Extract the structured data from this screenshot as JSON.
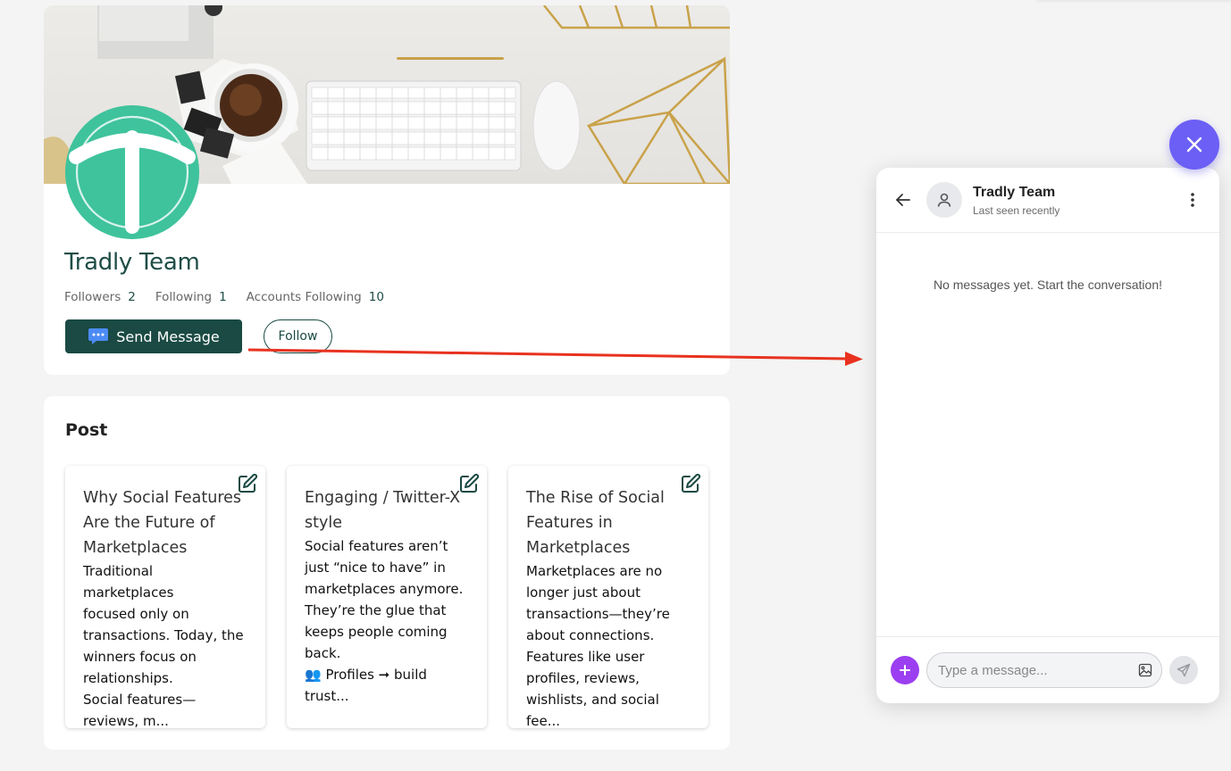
{
  "profile": {
    "name": "Tradly Team",
    "stats": [
      {
        "label": "Followers",
        "value": "2"
      },
      {
        "label": "Following",
        "value": "1"
      },
      {
        "label": "Accounts Following",
        "value": "10"
      }
    ],
    "send_message_label": "Send Message",
    "follow_label": "Follow"
  },
  "posts": {
    "heading": "Post",
    "items": [
      {
        "title": "Why Social Features\nAre the Future of\nMarketplaces",
        "body": "Traditional marketplaces\nfocused only on\ntransactions. Today, the\nwinners focus on\nrelationships.\nSocial features—\nreviews, m..."
      },
      {
        "title": "Engaging / Twitter-X\nstyle",
        "body": "Social features aren’t\njust “nice to have” in\nmarketplaces anymore.\nThey’re the glue that\nkeeps people coming\nback.\n👥 Profiles ➞ build\ntrust..."
      },
      {
        "title": "The Rise of Social\nFeatures in\nMarketplaces",
        "body": "Marketplaces are no\nlonger just about\ntransactions—they’re\nabout connections.\nFeatures like user\nprofiles, reviews,\nwishlists, and social fee..."
      }
    ]
  },
  "chat": {
    "name": "Tradly Team",
    "status": "Last seen recently",
    "empty_message": "No messages yet. Start the conversation!",
    "input_placeholder": "Type a message...",
    "input_value": ""
  },
  "colors": {
    "brand_dark": "#1a4a43",
    "avatar_green": "#3fc39d",
    "fab_purple": "#6b5ff5",
    "plus_purple": "#9b3ff0",
    "arrow_red": "#e8321f"
  },
  "icons": [
    "chat-bubble-icon",
    "edit-icon",
    "close-icon",
    "back-arrow-icon",
    "user-icon",
    "more-vertical-icon",
    "plus-icon",
    "image-icon",
    "send-icon"
  ]
}
